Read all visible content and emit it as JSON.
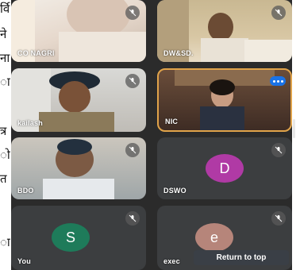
{
  "left_column_text": [
    "र्वि",
    "ने",
    "ना",
    "ा",
    "त्र",
    "ो",
    "त",
    "ा"
  ],
  "participants": [
    {
      "name": "CO NAGRI",
      "tile": "t1",
      "muted": true
    },
    {
      "name": "DW&SD.",
      "tile": "t2",
      "muted": true
    },
    {
      "name": "kailash",
      "tile": "t3",
      "muted": true
    },
    {
      "name": "NIC",
      "tile": "t4",
      "muted": false,
      "speaking": true
    },
    {
      "name": "BDO",
      "tile": "t5",
      "muted": true
    },
    {
      "name": "DSWO",
      "tile": "t6",
      "muted": true,
      "avatar_letter": "D",
      "avatar_color": "#b03aa5"
    },
    {
      "name": "You",
      "tile": "t7",
      "muted": true,
      "avatar_letter": "S",
      "avatar_color": "#1e7b5a"
    },
    {
      "name": "exec",
      "tile": "t8",
      "muted": true,
      "avatar_letter": "e",
      "avatar_color": "#b6857a"
    }
  ],
  "return_to_top_label": "Return to top",
  "colors": {
    "background": "#2b2b2b",
    "tile": "#3c3e40",
    "accent": "#1a73e8"
  }
}
